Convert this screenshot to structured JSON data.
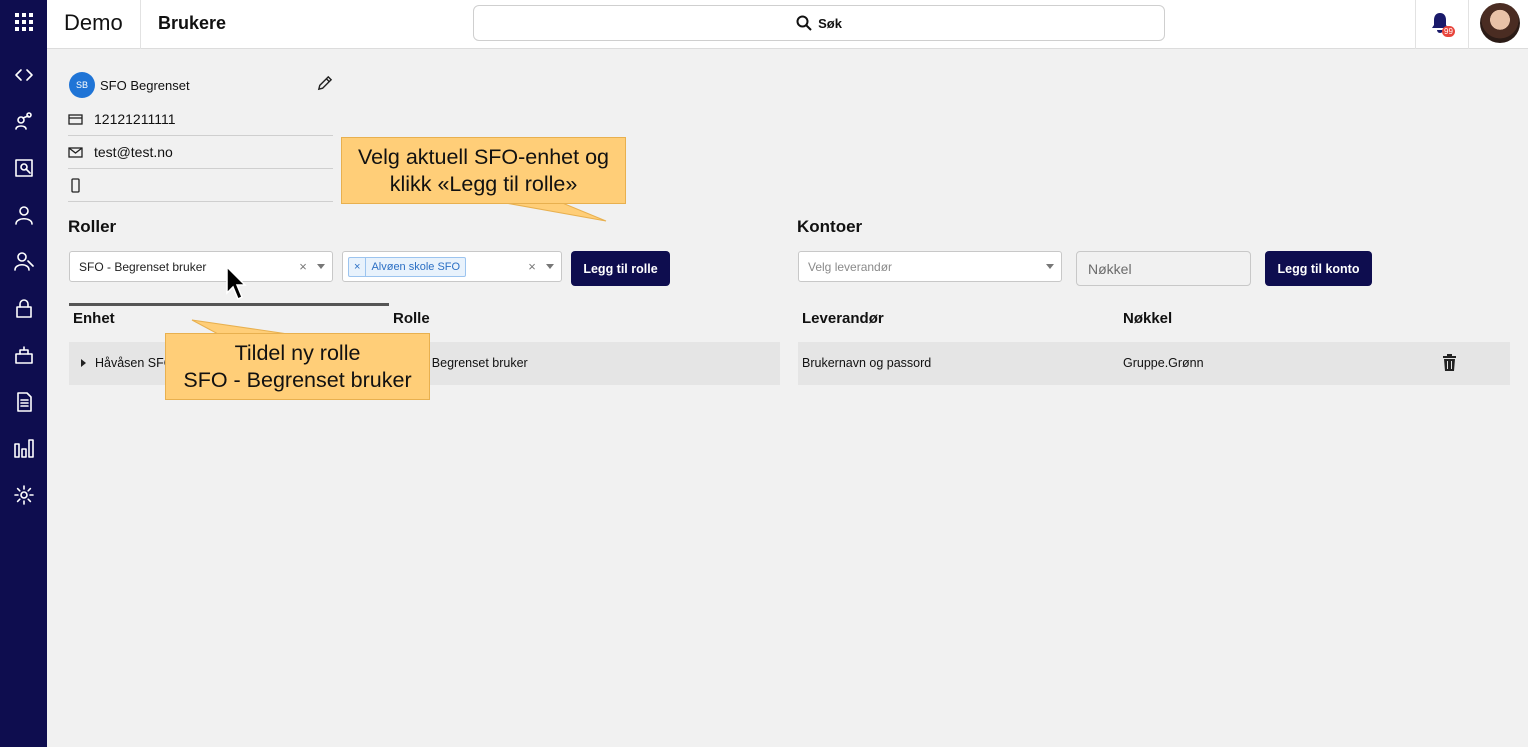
{
  "header": {
    "app_title": "Demo",
    "page_title": "Brukere",
    "search_label": "Søk",
    "notification_count": "99"
  },
  "nav": {
    "icons": [
      "apps-grid-icon",
      "code-icon",
      "users-network-icon",
      "report-search-icon",
      "user-icon",
      "user-group-icon",
      "lock-icon",
      "building-icon",
      "document-icon",
      "bar-chart-icon",
      "settings-icon"
    ]
  },
  "user": {
    "initials": "SB",
    "name": "SFO Begrenset",
    "id_number": "12121211111",
    "email": "test@test.no",
    "phone": ""
  },
  "roles": {
    "title": "Roller",
    "role_select_value": "SFO - Begrenset bruker",
    "unit_chip": "Alvøen skole SFO",
    "add_button": "Legg til rolle",
    "columns": [
      "Enhet",
      "Rolle"
    ],
    "rows": [
      {
        "unit": "Håvåsen SFO",
        "role": "SFO - Begrenset bruker"
      }
    ]
  },
  "accounts": {
    "title": "Kontoer",
    "supplier_placeholder": "Velg leverandør",
    "key_placeholder": "Nøkkel",
    "add_button": "Legg til konto",
    "columns": [
      "Leverandør",
      "Nøkkel"
    ],
    "rows": [
      {
        "supplier": "Brukernavn og passord",
        "key": "Gruppe.Grønn"
      }
    ]
  },
  "callouts": {
    "top_line1": "Velg aktuell SFO-enhet og",
    "top_line2": "klikk «Legg til rolle»",
    "bottom_line1": "Tildel ny rolle",
    "bottom_line2": "SFO - Begrenset bruker"
  },
  "colors": {
    "nav_bg": "#0e0d4f",
    "button_bg": "#0e0d4f",
    "callout_bg": "#ffce78",
    "avatar_bg": "#1f74d6",
    "badge": "#e8453c"
  }
}
